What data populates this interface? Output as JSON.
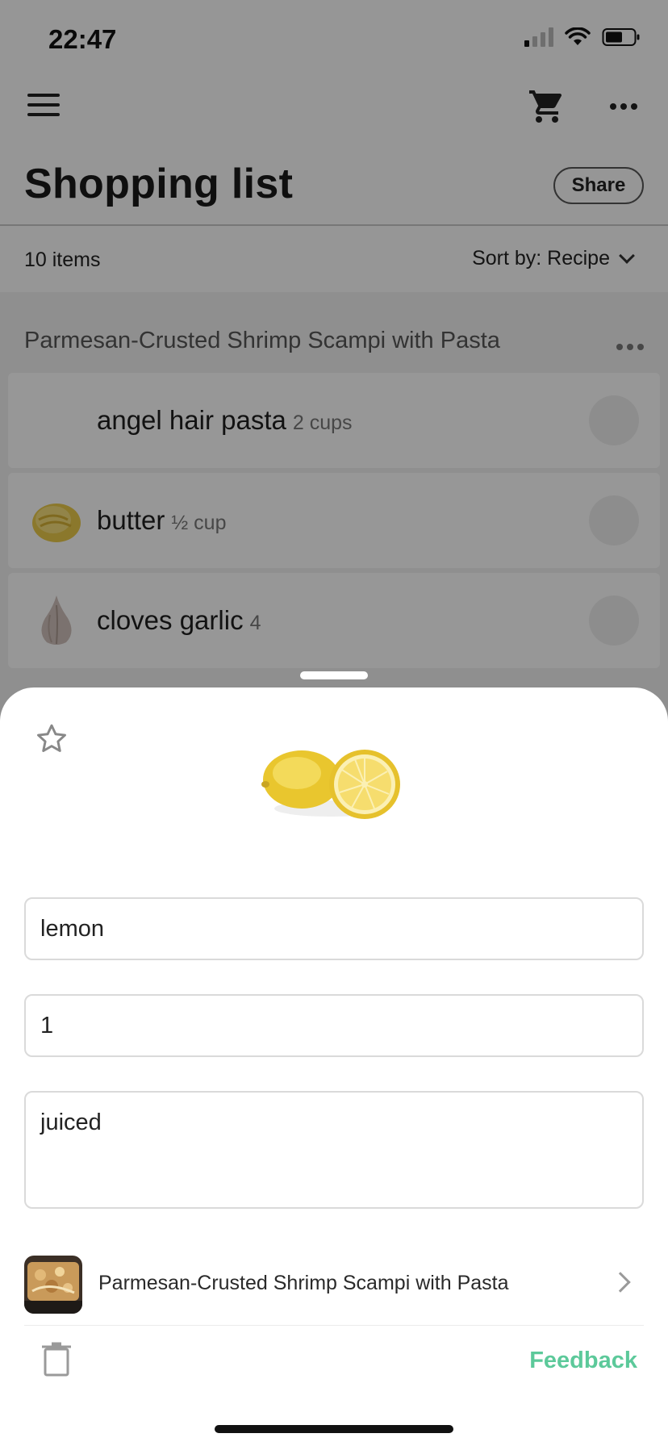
{
  "status_bar": {
    "time": "22:47"
  },
  "header": {
    "title": "Shopping list",
    "share_label": "Share"
  },
  "list_bar": {
    "item_count": "10 items",
    "sort_label": "Sort by: Recipe"
  },
  "recipe_group": {
    "title": "Parmesan-Crusted Shrimp Scampi with Pasta",
    "items": [
      {
        "name": "angel hair pasta",
        "quantity": "2  cups",
        "icon": "none"
      },
      {
        "name": "butter",
        "quantity": "½ cup",
        "icon": "butter-icon"
      },
      {
        "name": "cloves garlic",
        "quantity": "4",
        "icon": "garlic-icon"
      }
    ]
  },
  "sheet": {
    "name_value": "lemon",
    "quantity_value": "1",
    "notes_value": "juiced",
    "recipe_link_label": "Parmesan-Crusted Shrimp Scampi with Pasta",
    "feedback_label": "Feedback"
  },
  "colors": {
    "accent": "#5cc99a",
    "overlay": "#000000",
    "sheet_background": "#ffffff"
  }
}
